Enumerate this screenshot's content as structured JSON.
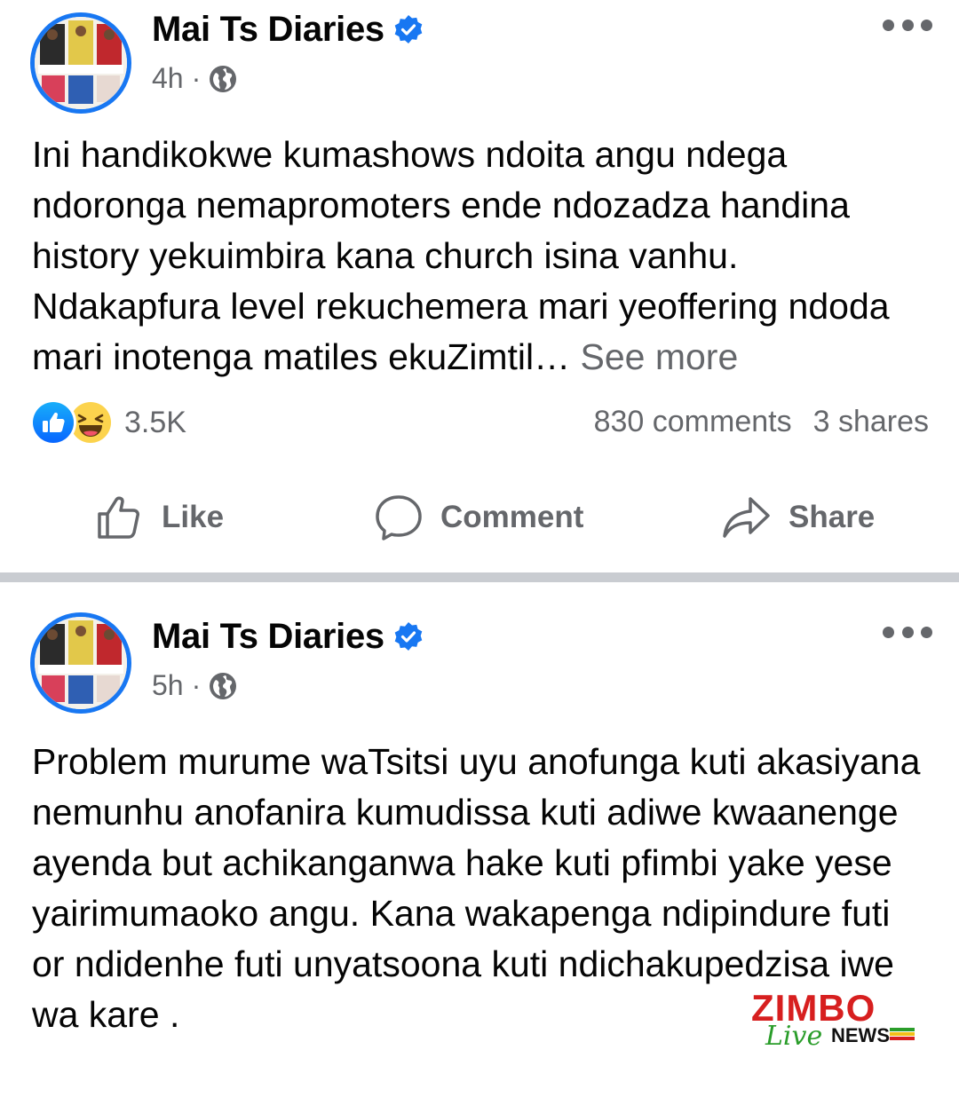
{
  "posts": [
    {
      "author": "Mai Ts Diaries",
      "time": "4h",
      "text": "Ini handikokwe kumashows ndoita angu ndega ndoronga nemapromoters ende ndozadza handina history yekuimbira kana church isina vanhu. Ndakapfura level rekuchemera mari yeoffering ndoda mari inotenga matiles ekuZimtil…",
      "see_more": "See more",
      "reactions_count": "3.5K",
      "comments": "830 comments",
      "shares": "3 shares",
      "actions": {
        "like": "Like",
        "comment": "Comment",
        "share": "Share"
      }
    },
    {
      "author": "Mai Ts Diaries",
      "time": "5h",
      "text": "Problem murume waTsitsi uyu anofunga kuti akasiyana nemunhu anofanira kumudissa kuti adiwe kwaanenge ayenda but achikanganwa hake kuti pfimbi yake yese yairimumaoko angu. Kana wakapenga ndipindure futi or ndidenhe futi unyatsoona kuti ndichakupedzisa iwe wa kare ."
    }
  ],
  "watermark": {
    "brand": "ZIMBO",
    "live": "Live",
    "news": "NEWS"
  },
  "colors": {
    "verified": "#1877f2",
    "meta_gray": "#65676b",
    "divider": "#c9ccd1",
    "brand_red": "#d71f1f",
    "brand_green": "#2a9d2a"
  },
  "icons": [
    "verified-badge-icon",
    "globe-icon",
    "more-options-icon",
    "like-reaction-icon",
    "haha-reaction-icon",
    "thumbs-up-icon",
    "comment-bubble-icon",
    "share-arrow-icon"
  ]
}
